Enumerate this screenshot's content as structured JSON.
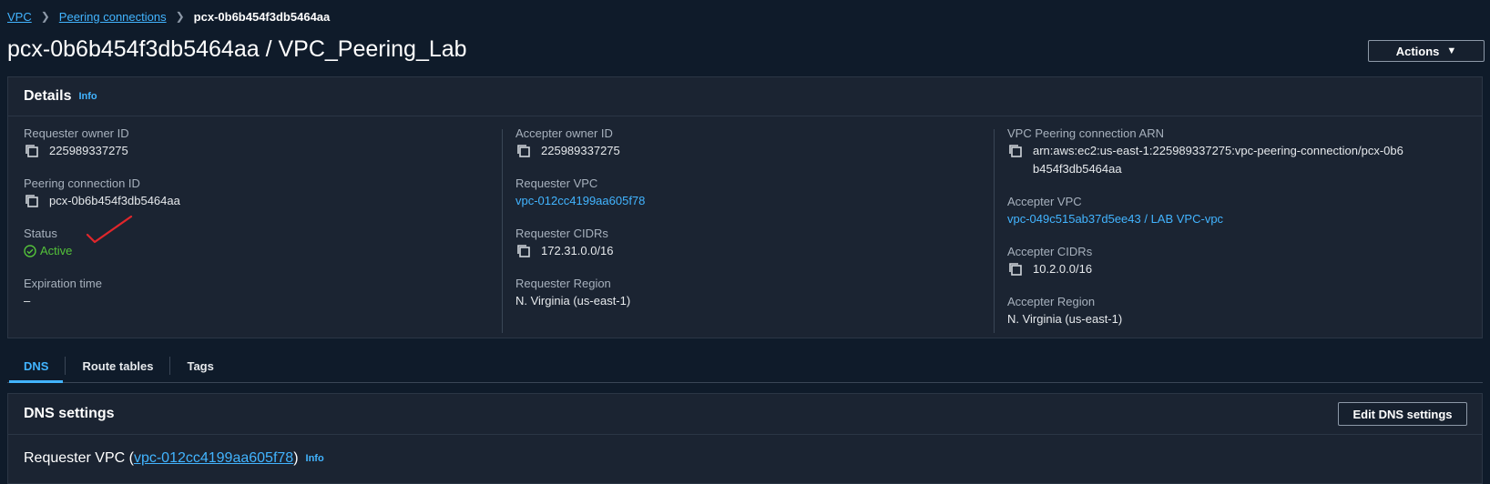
{
  "breadcrumb": {
    "vpc": "VPC",
    "peering": "Peering connections",
    "current": "pcx-0b6b454f3db5464aa"
  },
  "page_title": "pcx-0b6b454f3db5464aa / VPC_Peering_Lab",
  "actions_label": "Actions",
  "details": {
    "title": "Details",
    "info": "Info",
    "requester_owner_id_label": "Requester owner ID",
    "requester_owner_id": "225989337275",
    "peering_connection_id_label": "Peering connection ID",
    "peering_connection_id": "pcx-0b6b454f3db5464aa",
    "status_label": "Status",
    "status": "Active",
    "expiration_time_label": "Expiration time",
    "expiration_time": "–",
    "accepter_owner_id_label": "Accepter owner ID",
    "accepter_owner_id": "225989337275",
    "requester_vpc_label": "Requester VPC",
    "requester_vpc": "vpc-012cc4199aa605f78",
    "requester_cidrs_label": "Requester CIDRs",
    "requester_cidrs": "172.31.0.0/16",
    "requester_region_label": "Requester Region",
    "requester_region": "N. Virginia (us-east-1)",
    "arn_label": "VPC Peering connection ARN",
    "arn": "arn:aws:ec2:us-east-1:225989337275:vpc-peering-connection/pcx-0b6b454f3db5464aa",
    "accepter_vpc_label": "Accepter VPC",
    "accepter_vpc": "vpc-049c515ab37d5ee43 / LAB VPC-vpc",
    "accepter_cidrs_label": "Accepter CIDRs",
    "accepter_cidrs": "10.2.0.0/16",
    "accepter_region_label": "Accepter Region",
    "accepter_region": "N. Virginia (us-east-1)"
  },
  "tabs": [
    {
      "label": "DNS"
    },
    {
      "label": "Route tables"
    },
    {
      "label": "Tags"
    }
  ],
  "dns": {
    "title": "DNS settings",
    "edit_label": "Edit DNS settings",
    "requester_prefix": "Requester VPC (",
    "requester_vpc": "vpc-012cc4199aa605f78",
    "requester_suffix": ")",
    "info": "Info"
  },
  "colors": {
    "background": "#0f1b2a",
    "panel": "#1b2432",
    "link": "#42b4ff",
    "status_green": "#54c23a",
    "annotation_red": "#e0262b"
  }
}
